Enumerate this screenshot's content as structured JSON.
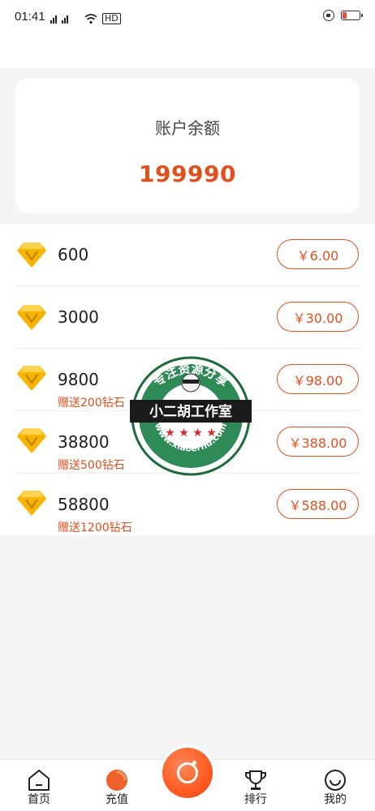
{
  "status_bar": {
    "time": "01:41",
    "network_icons": "4G  4G",
    "hd_label": "HD"
  },
  "balance": {
    "label": "账户余额",
    "value": "199990"
  },
  "packs": [
    {
      "amount": "600",
      "bonus": "",
      "price": "￥6.00"
    },
    {
      "amount": "3000",
      "bonus": "",
      "price": "￥30.00"
    },
    {
      "amount": "9800",
      "bonus": "赠送200钻石",
      "price": "￥98.00"
    },
    {
      "amount": "38800",
      "bonus": "赠送500钻石",
      "price": "￥388.00"
    },
    {
      "amount": "58800",
      "bonus": "赠送1200钻石",
      "price": "￥588.00"
    }
  ],
  "watermark": {
    "top_text": "专注资源分享",
    "banner_text": "小二胡工作室",
    "url_text": "www.xiaoerhu.com"
  },
  "tabs": [
    {
      "label": "首页",
      "icon": "home-icon"
    },
    {
      "label": "充值",
      "icon": "recharge-icon"
    },
    {
      "label": "",
      "icon": "camera-icon"
    },
    {
      "label": "排行",
      "icon": "trophy-icon"
    },
    {
      "label": "我的",
      "icon": "profile-icon"
    }
  ],
  "colors": {
    "accent": "#e2501e",
    "diamond_gold": "#f7b500",
    "background": "#f5f5f5"
  }
}
